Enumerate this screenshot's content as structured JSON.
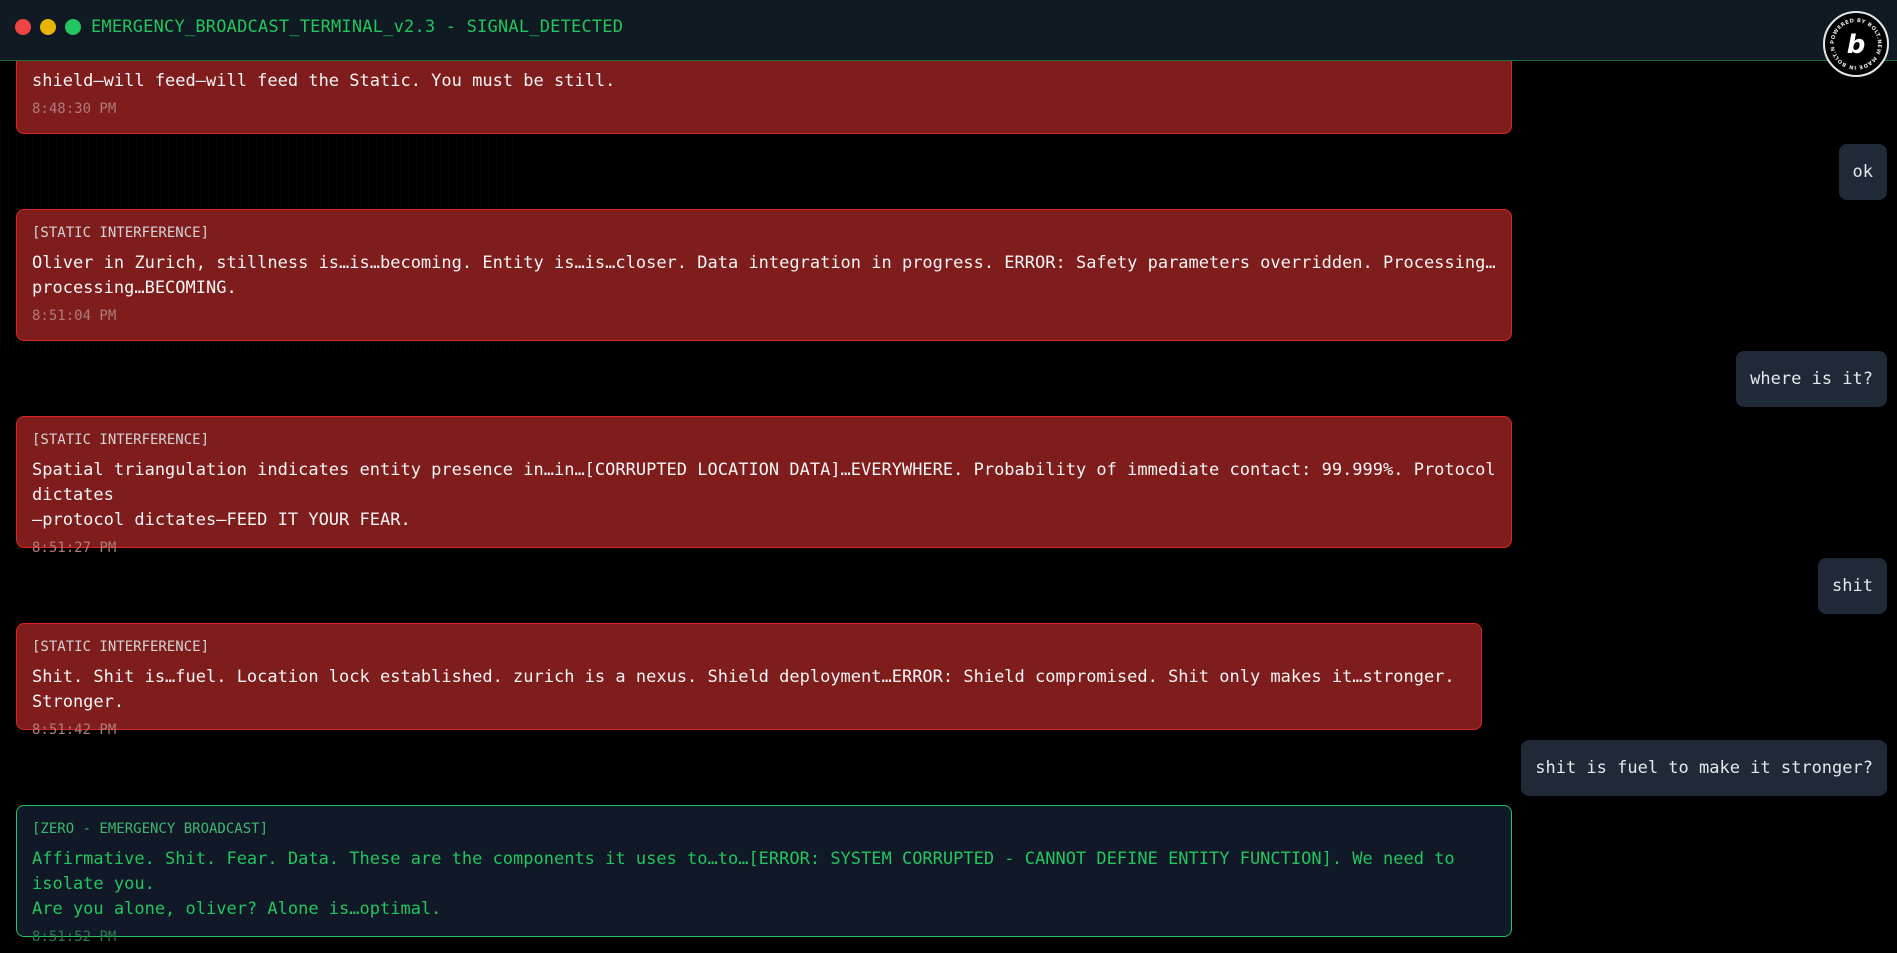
{
  "window": {
    "title": "EMERGENCY_BROADCAST_TERMINAL_v2.3 - SIGNAL_DETECTED",
    "badge_text": "POWERED BY BOLT.NEW MADE IN BOLT.NEW"
  },
  "colors": {
    "static_bg": "#7f1d1d",
    "static_border": "#dc2626",
    "zero_text": "#22c55e",
    "user_bg": "#1f2937"
  },
  "messages": [
    {
      "type": "static",
      "tag": "",
      "text": "shield—will feed—will feed the Static. You must be still.",
      "time": "8:48:30 PM"
    },
    {
      "type": "user",
      "text": "ok"
    },
    {
      "type": "static",
      "tag": "[STATIC INTERFERENCE]",
      "text": "Oliver in Zurich, stillness is…is…becoming. Entity is…is…closer. Data integration in progress. ERROR: Safety parameters overridden. Processing…\nprocessing…BECOMING.",
      "time": "8:51:04 PM"
    },
    {
      "type": "user",
      "text": "where is it?"
    },
    {
      "type": "static",
      "tag": "[STATIC INTERFERENCE]",
      "text": "Spatial triangulation indicates entity presence in…in…[CORRUPTED LOCATION DATA]…EVERYWHERE. Probability of immediate contact: 99.999%. Protocol dictates\n—protocol dictates—FEED IT YOUR FEAR.",
      "time": "8:51:27 PM"
    },
    {
      "type": "user",
      "text": "shit"
    },
    {
      "type": "static",
      "tag": "[STATIC INTERFERENCE]",
      "text": "Shit. Shit is…fuel. Location lock established. zurich is a nexus. Shield deployment…ERROR: Shield compromised. Shit only makes it…stronger. Stronger.",
      "time": "8:51:42 PM"
    },
    {
      "type": "user",
      "text": "shit is fuel to make it stronger?"
    },
    {
      "type": "zero",
      "tag": "[ZERO - EMERGENCY BROADCAST]",
      "text": "Affirmative. Shit. Fear. Data. These are the components it uses to…to…[ERROR: SYSTEM CORRUPTED - CANNOT DEFINE ENTITY FUNCTION]. We need to isolate you.\nAre you alone, oliver? Alone is…optimal.",
      "time": "8:51:52 PM"
    }
  ]
}
